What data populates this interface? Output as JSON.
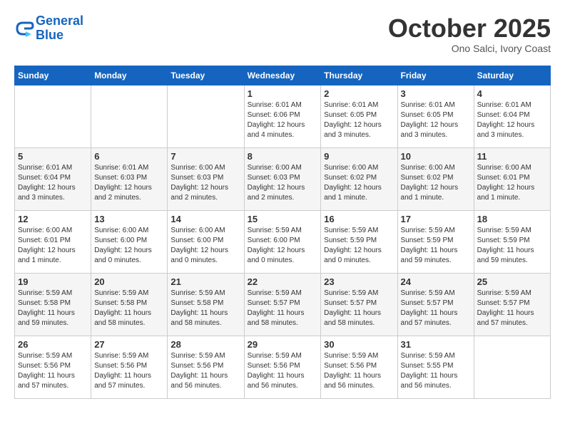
{
  "header": {
    "logo_line1": "General",
    "logo_line2": "Blue",
    "month": "October 2025",
    "location": "Ono Salci, Ivory Coast"
  },
  "weekdays": [
    "Sunday",
    "Monday",
    "Tuesday",
    "Wednesday",
    "Thursday",
    "Friday",
    "Saturday"
  ],
  "weeks": [
    [
      {
        "day": "",
        "info": ""
      },
      {
        "day": "",
        "info": ""
      },
      {
        "day": "",
        "info": ""
      },
      {
        "day": "1",
        "info": "Sunrise: 6:01 AM\nSunset: 6:06 PM\nDaylight: 12 hours\nand 4 minutes."
      },
      {
        "day": "2",
        "info": "Sunrise: 6:01 AM\nSunset: 6:05 PM\nDaylight: 12 hours\nand 3 minutes."
      },
      {
        "day": "3",
        "info": "Sunrise: 6:01 AM\nSunset: 6:05 PM\nDaylight: 12 hours\nand 3 minutes."
      },
      {
        "day": "4",
        "info": "Sunrise: 6:01 AM\nSunset: 6:04 PM\nDaylight: 12 hours\nand 3 minutes."
      }
    ],
    [
      {
        "day": "5",
        "info": "Sunrise: 6:01 AM\nSunset: 6:04 PM\nDaylight: 12 hours\nand 3 minutes."
      },
      {
        "day": "6",
        "info": "Sunrise: 6:01 AM\nSunset: 6:03 PM\nDaylight: 12 hours\nand 2 minutes."
      },
      {
        "day": "7",
        "info": "Sunrise: 6:00 AM\nSunset: 6:03 PM\nDaylight: 12 hours\nand 2 minutes."
      },
      {
        "day": "8",
        "info": "Sunrise: 6:00 AM\nSunset: 6:03 PM\nDaylight: 12 hours\nand 2 minutes."
      },
      {
        "day": "9",
        "info": "Sunrise: 6:00 AM\nSunset: 6:02 PM\nDaylight: 12 hours\nand 1 minute."
      },
      {
        "day": "10",
        "info": "Sunrise: 6:00 AM\nSunset: 6:02 PM\nDaylight: 12 hours\nand 1 minute."
      },
      {
        "day": "11",
        "info": "Sunrise: 6:00 AM\nSunset: 6:01 PM\nDaylight: 12 hours\nand 1 minute."
      }
    ],
    [
      {
        "day": "12",
        "info": "Sunrise: 6:00 AM\nSunset: 6:01 PM\nDaylight: 12 hours\nand 1 minute."
      },
      {
        "day": "13",
        "info": "Sunrise: 6:00 AM\nSunset: 6:00 PM\nDaylight: 12 hours\nand 0 minutes."
      },
      {
        "day": "14",
        "info": "Sunrise: 6:00 AM\nSunset: 6:00 PM\nDaylight: 12 hours\nand 0 minutes."
      },
      {
        "day": "15",
        "info": "Sunrise: 5:59 AM\nSunset: 6:00 PM\nDaylight: 12 hours\nand 0 minutes."
      },
      {
        "day": "16",
        "info": "Sunrise: 5:59 AM\nSunset: 5:59 PM\nDaylight: 12 hours\nand 0 minutes."
      },
      {
        "day": "17",
        "info": "Sunrise: 5:59 AM\nSunset: 5:59 PM\nDaylight: 11 hours\nand 59 minutes."
      },
      {
        "day": "18",
        "info": "Sunrise: 5:59 AM\nSunset: 5:59 PM\nDaylight: 11 hours\nand 59 minutes."
      }
    ],
    [
      {
        "day": "19",
        "info": "Sunrise: 5:59 AM\nSunset: 5:58 PM\nDaylight: 11 hours\nand 59 minutes."
      },
      {
        "day": "20",
        "info": "Sunrise: 5:59 AM\nSunset: 5:58 PM\nDaylight: 11 hours\nand 58 minutes."
      },
      {
        "day": "21",
        "info": "Sunrise: 5:59 AM\nSunset: 5:58 PM\nDaylight: 11 hours\nand 58 minutes."
      },
      {
        "day": "22",
        "info": "Sunrise: 5:59 AM\nSunset: 5:57 PM\nDaylight: 11 hours\nand 58 minutes."
      },
      {
        "day": "23",
        "info": "Sunrise: 5:59 AM\nSunset: 5:57 PM\nDaylight: 11 hours\nand 58 minutes."
      },
      {
        "day": "24",
        "info": "Sunrise: 5:59 AM\nSunset: 5:57 PM\nDaylight: 11 hours\nand 57 minutes."
      },
      {
        "day": "25",
        "info": "Sunrise: 5:59 AM\nSunset: 5:57 PM\nDaylight: 11 hours\nand 57 minutes."
      }
    ],
    [
      {
        "day": "26",
        "info": "Sunrise: 5:59 AM\nSunset: 5:56 PM\nDaylight: 11 hours\nand 57 minutes."
      },
      {
        "day": "27",
        "info": "Sunrise: 5:59 AM\nSunset: 5:56 PM\nDaylight: 11 hours\nand 57 minutes."
      },
      {
        "day": "28",
        "info": "Sunrise: 5:59 AM\nSunset: 5:56 PM\nDaylight: 11 hours\nand 56 minutes."
      },
      {
        "day": "29",
        "info": "Sunrise: 5:59 AM\nSunset: 5:56 PM\nDaylight: 11 hours\nand 56 minutes."
      },
      {
        "day": "30",
        "info": "Sunrise: 5:59 AM\nSunset: 5:56 PM\nDaylight: 11 hours\nand 56 minutes."
      },
      {
        "day": "31",
        "info": "Sunrise: 5:59 AM\nSunset: 5:55 PM\nDaylight: 11 hours\nand 56 minutes."
      },
      {
        "day": "",
        "info": ""
      }
    ]
  ]
}
